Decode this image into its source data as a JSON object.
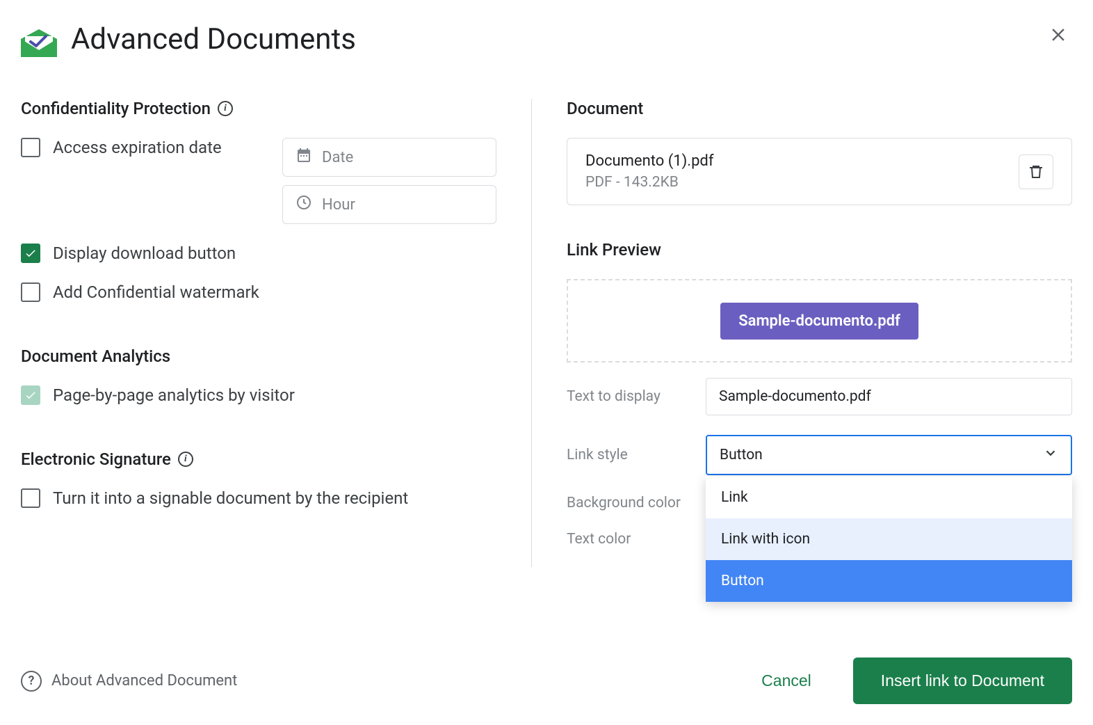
{
  "dialog": {
    "title": "Advanced Documents"
  },
  "left": {
    "confidentiality": {
      "title": "Confidentiality Protection",
      "access_expiration": "Access expiration date",
      "date_placeholder": "Date",
      "hour_placeholder": "Hour",
      "display_download": "Display download button",
      "add_watermark": "Add Confidential watermark"
    },
    "analytics": {
      "title": "Document Analytics",
      "page_by_page": "Page-by-page analytics by visitor"
    },
    "signature": {
      "title": "Electronic Signature",
      "signable": "Turn it into a signable document by the recipient"
    }
  },
  "right": {
    "document_title": "Document",
    "doc_name": "Documento (1).pdf",
    "doc_meta": "PDF - 143.2KB",
    "link_preview_title": "Link Preview",
    "preview_button_text": "Sample-documento.pdf",
    "text_to_display_label": "Text to display",
    "text_to_display_value": "Sample-documento.pdf",
    "link_style_label": "Link style",
    "link_style_value": "Button",
    "link_style_options": [
      "Link",
      "Link with icon",
      "Button"
    ],
    "background_color_label": "Background color",
    "text_color_label": "Text color"
  },
  "footer": {
    "about": "About Advanced Document",
    "cancel": "Cancel",
    "insert": "Insert link to Document"
  }
}
